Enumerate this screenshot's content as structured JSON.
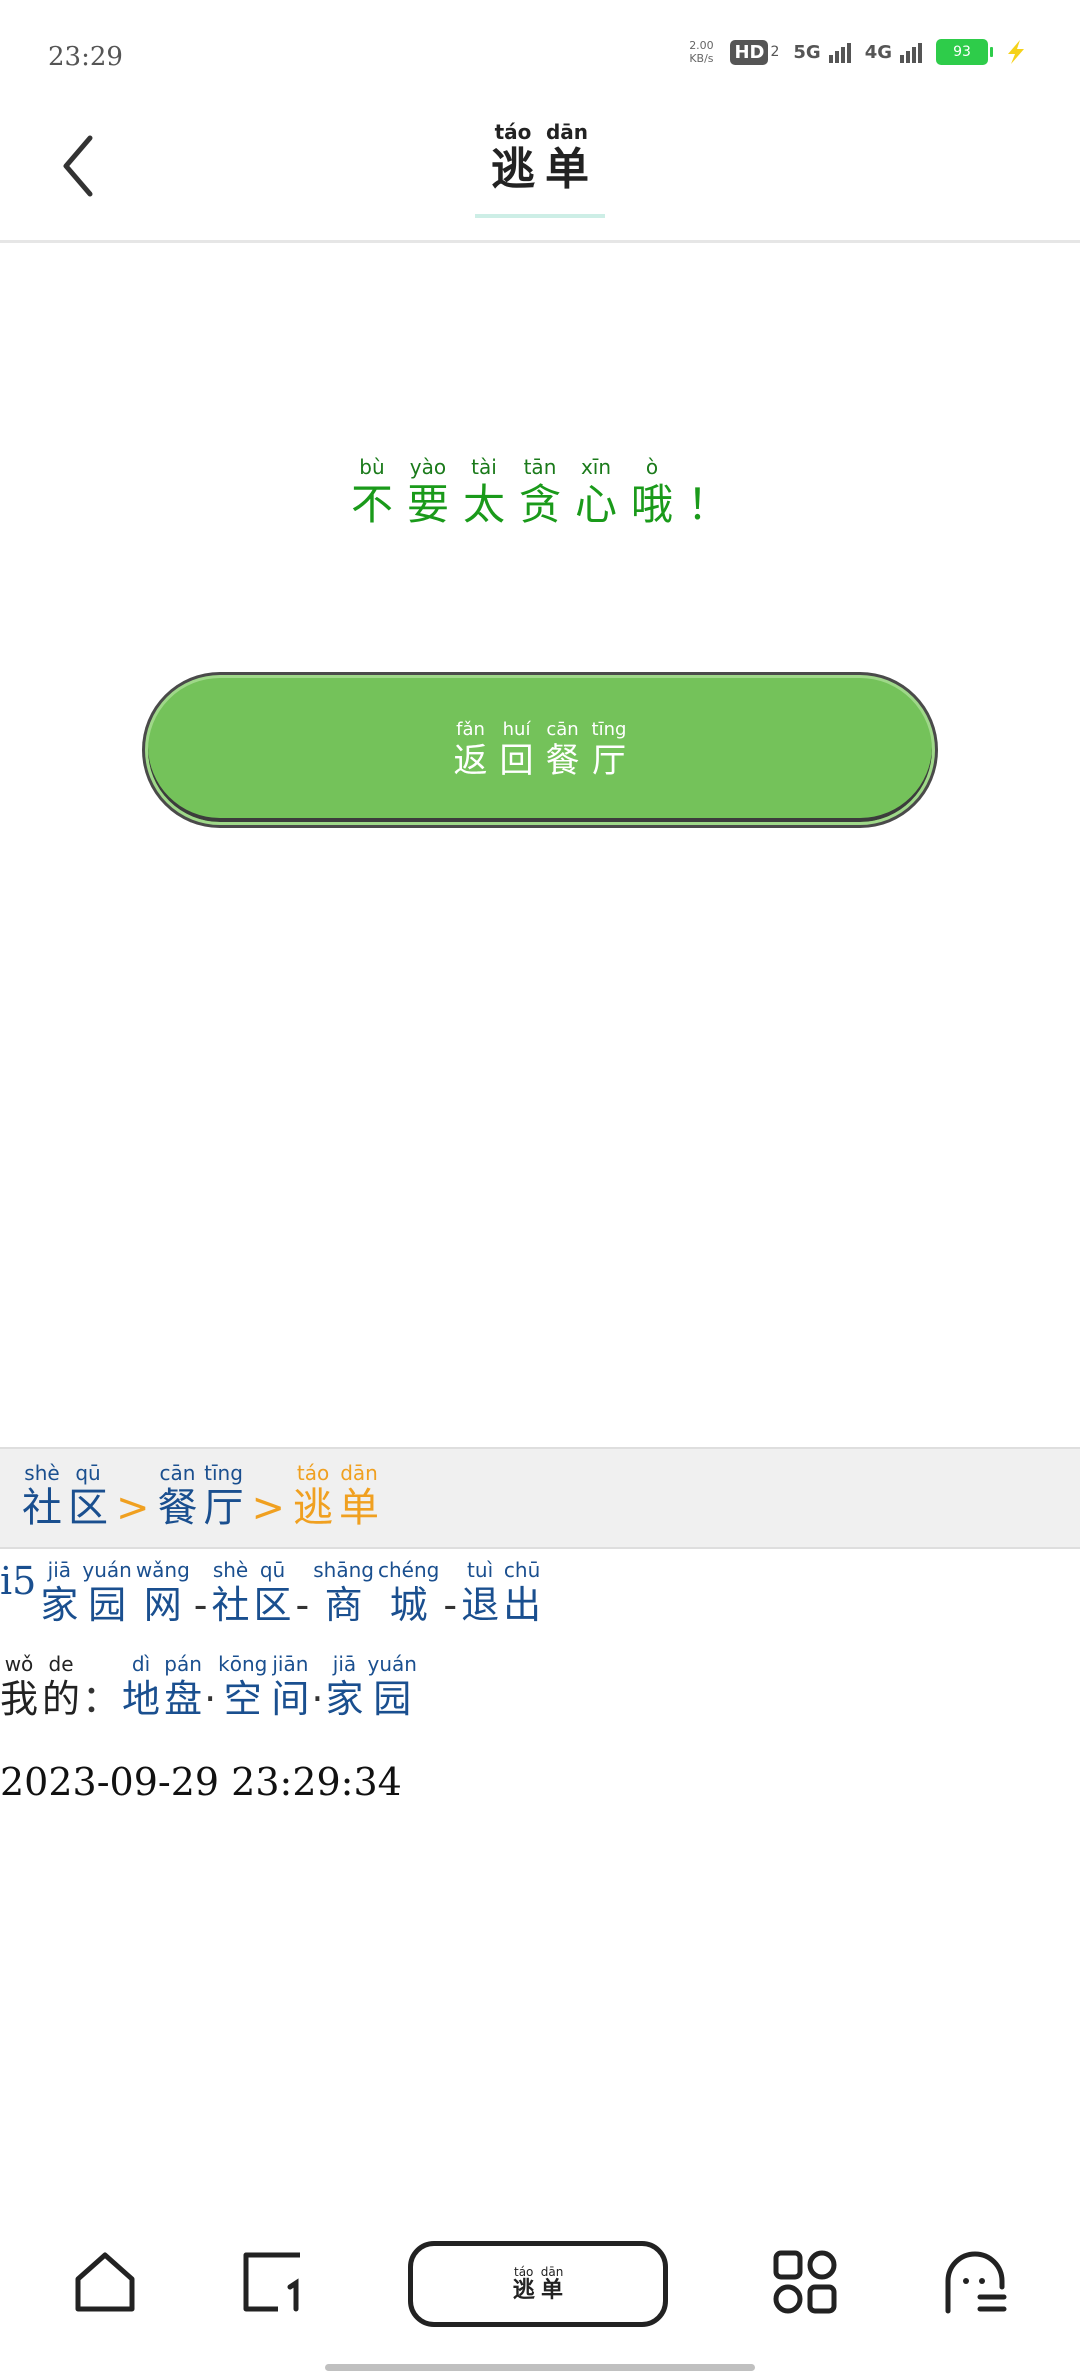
{
  "status_bar": {
    "time": "23:29",
    "net_speed_value": "2.00",
    "net_speed_unit": "KB/s",
    "hd": "HD",
    "hd_sub": "2",
    "net1": "5G",
    "net2": "4G",
    "battery": "93"
  },
  "header": {
    "title": [
      {
        "py": "táo",
        "hz": "逃"
      },
      {
        "py": "dān",
        "hz": "单"
      }
    ]
  },
  "message": [
    {
      "py": "bù",
      "hz": "不"
    },
    {
      "py": "yào",
      "hz": "要"
    },
    {
      "py": "tài",
      "hz": "太"
    },
    {
      "py": "tān",
      "hz": "贪"
    },
    {
      "py": "xīn",
      "hz": "心"
    },
    {
      "py": "ò",
      "hz": "哦"
    },
    {
      "py": "",
      "hz": "！"
    }
  ],
  "return_button": [
    {
      "py": "fǎn",
      "hz": "返"
    },
    {
      "py": "huí",
      "hz": "回"
    },
    {
      "py": "cān",
      "hz": "餐"
    },
    {
      "py": "tīng",
      "hz": "厅"
    }
  ],
  "breadcrumb": {
    "separator": ">",
    "community": [
      {
        "py": "shè",
        "hz": "社"
      },
      {
        "py": "qū",
        "hz": "区"
      }
    ],
    "restaurant": [
      {
        "py": "cān",
        "hz": "餐"
      },
      {
        "py": "tīng",
        "hz": "厅"
      }
    ],
    "current": [
      {
        "py": "táo",
        "hz": "逃"
      },
      {
        "py": "dān",
        "hz": "单"
      }
    ]
  },
  "links": {
    "prefix": "i5",
    "dash": "-",
    "homeland_net": [
      {
        "py": "jiā",
        "hz": "家"
      },
      {
        "py": "yuán",
        "hz": "园"
      },
      {
        "py": "wǎng",
        "hz": "网"
      }
    ],
    "community": [
      {
        "py": "shè",
        "hz": "社"
      },
      {
        "py": "qū",
        "hz": "区"
      }
    ],
    "mall": [
      {
        "py": "shāng",
        "hz": "商"
      },
      {
        "py": "chéng",
        "hz": "城"
      }
    ],
    "logout": [
      {
        "py": "tuì",
        "hz": "退"
      },
      {
        "py": "chū",
        "hz": "出"
      }
    ]
  },
  "mine": {
    "label": [
      {
        "py": "wǒ",
        "hz": "我"
      },
      {
        "py": "de",
        "hz": "的"
      }
    ],
    "colon": "：",
    "dot": "·",
    "territory": [
      {
        "py": "dì",
        "hz": "地"
      },
      {
        "py": "pán",
        "hz": "盘"
      }
    ],
    "space": [
      {
        "py": "kōng",
        "hz": "空"
      },
      {
        "py": "jiān",
        "hz": "间"
      }
    ],
    "homeland": [
      {
        "py": "jiā",
        "hz": "家"
      },
      {
        "py": "yuán",
        "hz": "园"
      }
    ]
  },
  "datetime": "2023-09-29 23:29:34",
  "bottom_nav": {
    "center": [
      {
        "py": "táo",
        "hz": "逃"
      },
      {
        "py": "dān",
        "hz": "单"
      }
    ]
  },
  "colors": {
    "button_green": "#74c25a",
    "message_green": "#1a9a1a",
    "link_blue": "#1a4f8f",
    "accent_orange": "#f0a020"
  }
}
